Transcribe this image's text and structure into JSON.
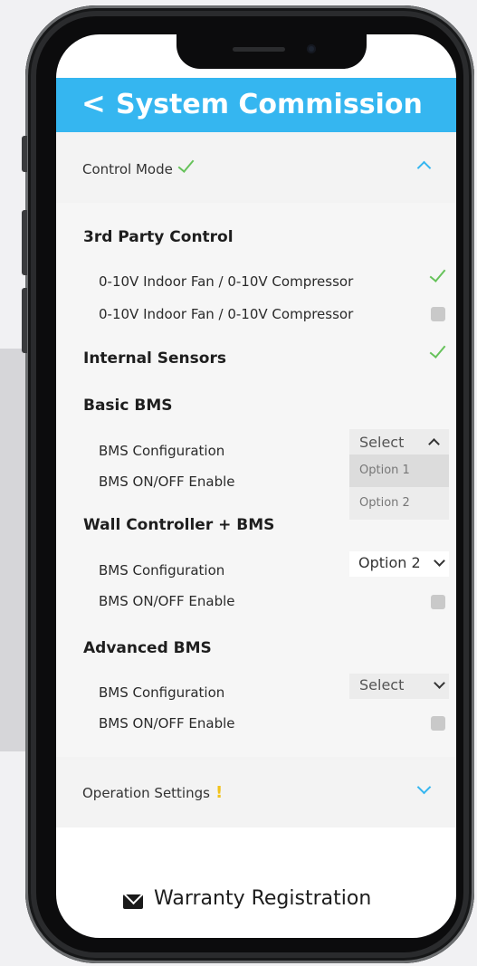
{
  "header": {
    "back_glyph": "<",
    "title": "System Commission"
  },
  "control_mode": {
    "label": "Control Mode",
    "status_icon": "check-icon",
    "expand_icon": "chevron-up-icon"
  },
  "groups": {
    "third_party": {
      "title": "3rd Party Control",
      "items": [
        {
          "label": "0-10V Indoor Fan / 0-10V Compressor",
          "checked": true
        },
        {
          "label": "0-10V Indoor Fan / 0-10V Compressor",
          "checked": false
        }
      ]
    },
    "internal_sensors": {
      "title": "Internal Sensors",
      "checked": true
    },
    "basic_bms": {
      "title": "Basic BMS",
      "config_label": "BMS Configuration",
      "enable_label": "BMS ON/OFF Enable",
      "select_value": "Select",
      "options": [
        "Option 1",
        "Option 2"
      ]
    },
    "wall_controller": {
      "title": "Wall Controller + BMS",
      "config_label": "BMS Configuration",
      "enable_label": "BMS ON/OFF Enable",
      "select_value": "Option 2",
      "enable_checked": false
    },
    "advanced_bms": {
      "title": "Advanced BMS",
      "config_label": "BMS Configuration",
      "enable_label": "BMS ON/OFF Enable",
      "select_value": "Select",
      "enable_checked": false
    }
  },
  "operation_settings": {
    "label": "Operation Settings",
    "status_glyph": "!",
    "expand_icon": "chevron-down-icon"
  },
  "footer": {
    "icon": "envelope-icon",
    "label": "Warranty Registration"
  },
  "colors": {
    "accent": "#35b6f0",
    "check": "#66c25a",
    "warning": "#f2c21a"
  }
}
